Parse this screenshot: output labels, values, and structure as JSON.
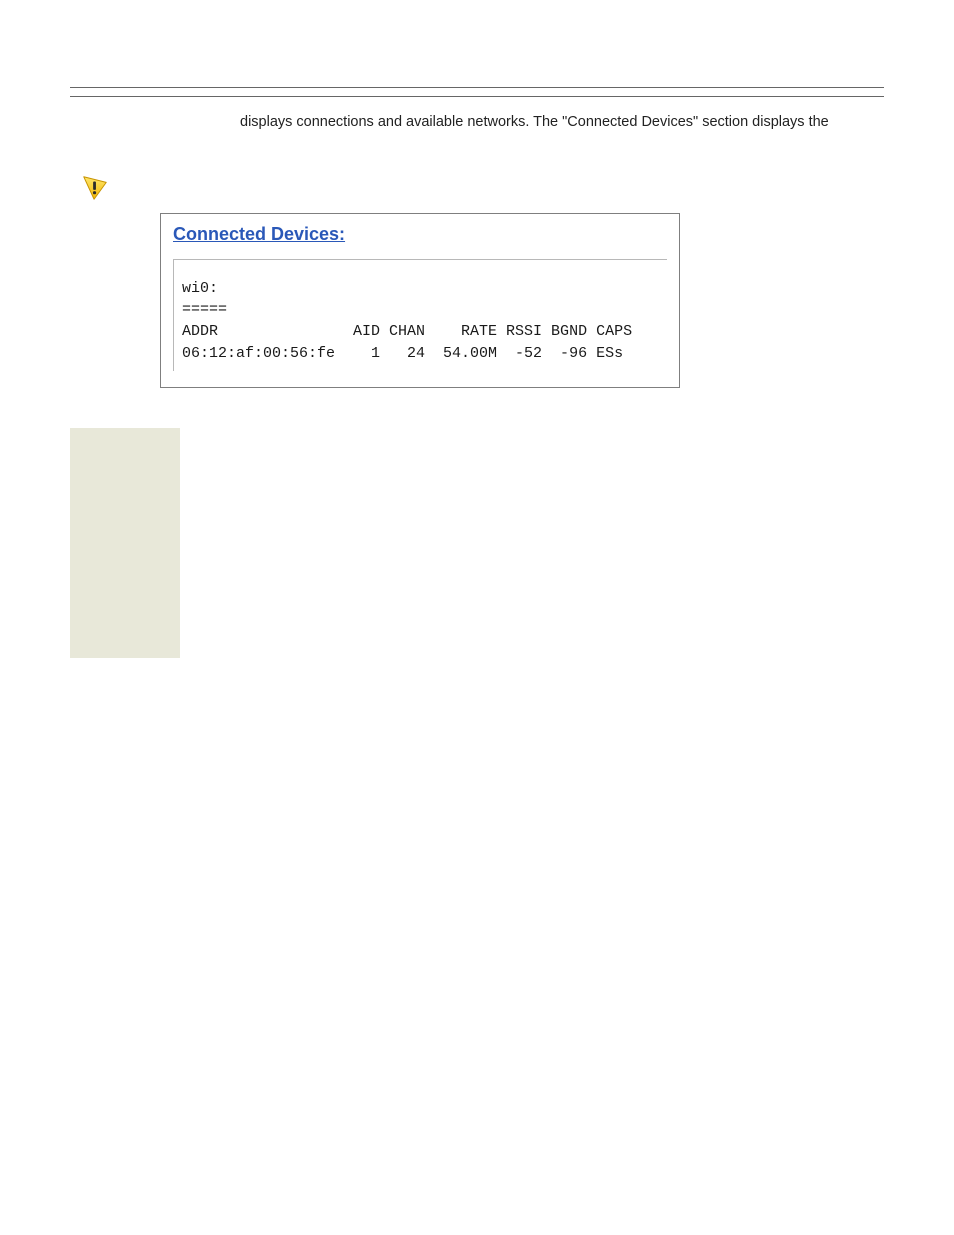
{
  "intro_text": "displays connections and available networks. The \"Connected Devices\" section displays the",
  "screenshot": {
    "title": "Connected Devices:",
    "line1": "wi0:",
    "line2": "=====",
    "line3": "ADDR               AID CHAN    RATE RSSI BGND CAPS",
    "line4": "06:12:af:00:56:fe    1   24  54.00M  -52  -96 ESs"
  }
}
